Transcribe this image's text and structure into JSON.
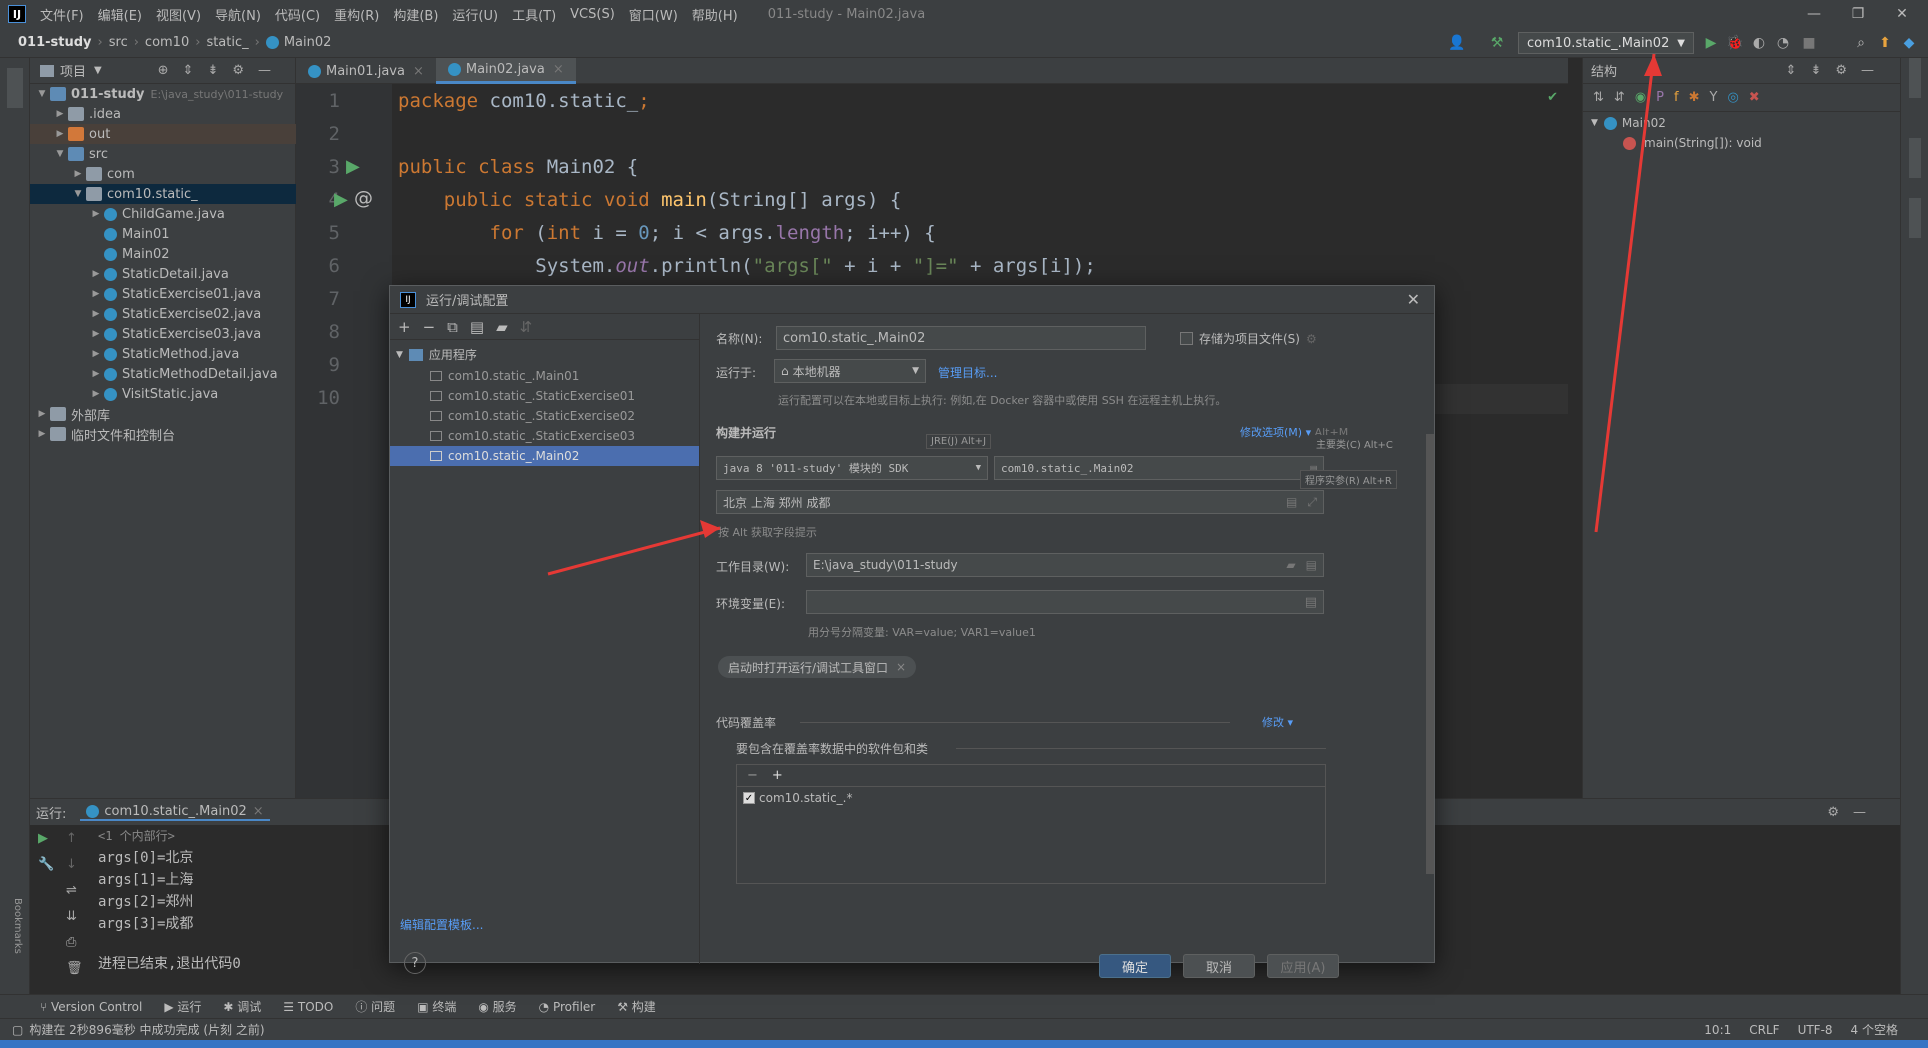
{
  "menubar": {
    "logo": "IJ",
    "items": [
      "文件(F)",
      "编辑(E)",
      "视图(V)",
      "导航(N)",
      "代码(C)",
      "重构(R)",
      "构建(B)",
      "运行(U)",
      "工具(T)",
      "VCS(S)",
      "窗口(W)",
      "帮助(H)"
    ],
    "title": "011-study - Main02.java"
  },
  "breadcrumb": [
    "011-study",
    "src",
    "com10",
    "static_",
    "Main02"
  ],
  "run_config": "com10.static_.Main02",
  "project": {
    "header": "项目",
    "tree": [
      {
        "label": "011-study",
        "extra": "E:\\java_study\\011-study",
        "level": 0,
        "open": true,
        "kind": "module"
      },
      {
        "label": ".idea",
        "level": 1,
        "open": false,
        "kind": "folder"
      },
      {
        "label": "out",
        "level": 1,
        "open": false,
        "kind": "folder-o",
        "hl": true
      },
      {
        "label": "src",
        "level": 1,
        "open": true,
        "kind": "folder-b"
      },
      {
        "label": "com",
        "level": 2,
        "open": false,
        "kind": "pkg"
      },
      {
        "label": "com10.static_",
        "level": 2,
        "open": true,
        "kind": "pkg",
        "sel": true
      },
      {
        "label": "ChildGame.java",
        "level": 3,
        "open": false,
        "kind": "cls"
      },
      {
        "label": "Main01",
        "level": 3,
        "kind": "cls",
        "leaf": true
      },
      {
        "label": "Main02",
        "level": 3,
        "kind": "cls",
        "leaf": true
      },
      {
        "label": "StaticDetail.java",
        "level": 3,
        "open": false,
        "kind": "cls"
      },
      {
        "label": "StaticExercise01.java",
        "level": 3,
        "open": false,
        "kind": "cls"
      },
      {
        "label": "StaticExercise02.java",
        "level": 3,
        "open": false,
        "kind": "cls"
      },
      {
        "label": "StaticExercise03.java",
        "level": 3,
        "open": false,
        "kind": "cls"
      },
      {
        "label": "StaticMethod.java",
        "level": 3,
        "open": false,
        "kind": "cls"
      },
      {
        "label": "StaticMethodDetail.java",
        "level": 3,
        "open": false,
        "kind": "cls"
      },
      {
        "label": "VisitStatic.java",
        "level": 3,
        "open": false,
        "kind": "cls"
      },
      {
        "label": "外部库",
        "level": 0,
        "open": false,
        "kind": "lib"
      },
      {
        "label": "临时文件和控制台",
        "level": 0,
        "open": false,
        "kind": "scratch"
      }
    ]
  },
  "tabs": [
    "Main01.java",
    "Main02.java"
  ],
  "editor": {
    "line_numbers": [
      "1",
      "2",
      "3",
      "4",
      "5",
      "6",
      "7",
      "8",
      "9",
      "10"
    ],
    "lines": {
      "l1a": "package ",
      "l1b": "com10.static_",
      ";": ";",
      "l3a": "public class ",
      "l3b": "Main02 {",
      "l4a": "    public static void ",
      "l4b": "main",
      "l4c": "(String[] args) {",
      "l5a": "        for ",
      "l5b": "(",
      "l5c": "int ",
      "l5d": "i = ",
      "l5e": "0",
      "l5f": "; i < args.",
      "l5g": "length",
      "l5h": "; i++) {",
      "l6a": "            System.",
      "l6b": "out",
      "l6c": ".println(",
      "l6d": "\"args[\"",
      "l6e": " + i + ",
      "l6f": "\"]=\"",
      "l6g": " + args[i]);"
    }
  },
  "structure": {
    "header": "结构",
    "class": "Main02",
    "method": "main(String[]): void"
  },
  "run": {
    "label": "运行:",
    "tab": "com10.static_.Main02",
    "output": [
      "<1 个内部行>",
      "args[0]=北京",
      "args[1]=上海",
      "args[2]=郑州",
      "args[3]=成都",
      "",
      "进程已结束,退出代码0"
    ]
  },
  "bottom_tools": [
    "Version Control",
    "运行",
    "调试",
    "TODO",
    "问题",
    "终端",
    "服务",
    "Profiler",
    "构建"
  ],
  "status": {
    "message": "构建在 2秒896毫秒 中成功完成 (片刻 之前)",
    "pos": "10:1",
    "eol": "CRLF",
    "enc": "UTF-8",
    "indent": "4 个空格"
  },
  "dialog": {
    "title": "运行/调试配置",
    "group": "应用程序",
    "configs": [
      "com10.static_.Main01",
      "com10.static_.StaticExercise01",
      "com10.static_.StaticExercise02",
      "com10.static_.StaticExercise03",
      "com10.static_.Main02"
    ],
    "edit_templates": "编辑配置模板...",
    "name_label": "名称(N):",
    "name_value": "com10.static_.Main02",
    "store_label": "存储为项目文件(S)",
    "run_on_label": "运行于:",
    "run_on_value": "本地机器",
    "manage_targets": "管理目标...",
    "run_on_hint": "运行配置可以在本地或目标上执行: 例如,在 Docker 容器中或使用 SSH 在远程主机上执行。",
    "build_run": "构建并运行",
    "modify_options": "修改选项(M)",
    "modify_shortcut": "Alt+M",
    "jre_tip": "JRE(J) Alt+J",
    "main_class_tip": "主要类(C) Alt+C",
    "args_tip": "程序实参(R) Alt+R",
    "sdk_value": "java 8 '011-study' 模块的 SDK",
    "main_class": "com10.static_.Main02",
    "program_args": "北京 上海 郑州 成都",
    "alt_hint": "按 Alt 获取字段提示",
    "workdir_label": "工作目录(W):",
    "workdir_value": "E:\\java_study\\011-study",
    "env_label": "环境变量(E):",
    "env_hint": "用分号分隔变量: VAR=value; VAR1=value1",
    "open_tool_window": "启动时打开运行/调试工具窗口",
    "coverage": "代码覆盖率",
    "coverage_modify": "修改",
    "coverage_include": "要包含在覆盖率数据中的软件包和类",
    "coverage_item": "com10.static_.*",
    "ok": "确定",
    "cancel": "取消",
    "apply": "应用(A)"
  },
  "colors": {
    "accent": "#4a88c7",
    "arrow": "#e53935"
  }
}
